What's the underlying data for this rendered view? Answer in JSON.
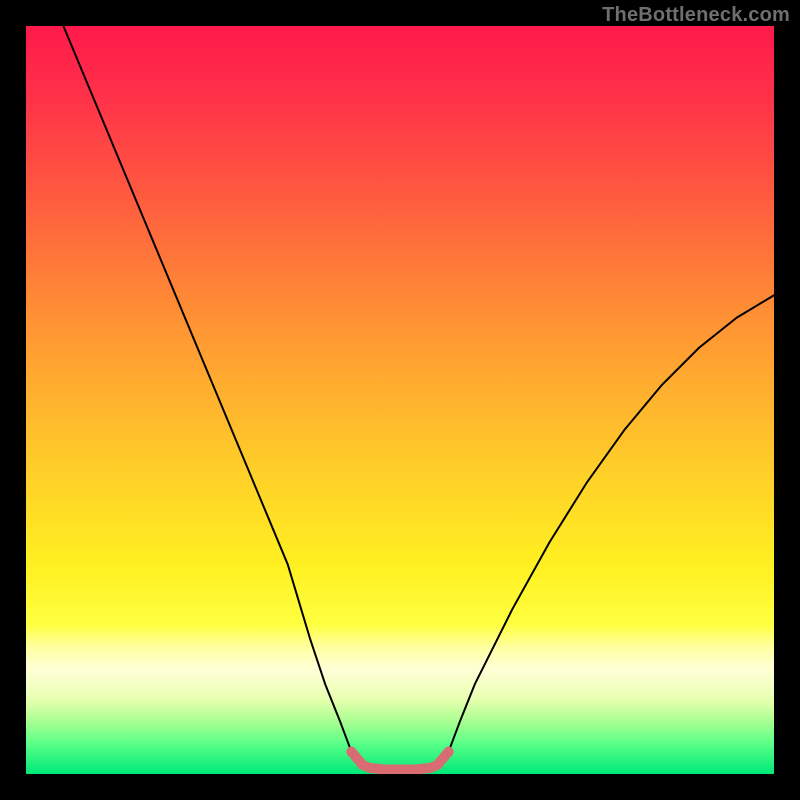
{
  "watermark": "TheBottleneck.com",
  "chart_data": {
    "type": "line",
    "title": "",
    "xlabel": "",
    "ylabel": "",
    "xlim": [
      0,
      100
    ],
    "ylim": [
      0,
      100
    ],
    "background_gradient": {
      "top": "#ff1a4b",
      "mid_upper": "#ff8436",
      "mid": "#ffd028",
      "mid_lower": "#ffff40",
      "bottom": "#00e878"
    },
    "series": [
      {
        "name": "bottleneck-curve",
        "color": "#000000",
        "width": 2,
        "x": [
          5,
          10,
          15,
          20,
          25,
          30,
          35,
          38,
          40,
          42,
          43.5,
          46,
          50,
          54,
          56.5,
          58,
          60,
          65,
          70,
          75,
          80,
          85,
          90,
          95,
          100
        ],
        "y": [
          100,
          88,
          76,
          64,
          52,
          40,
          28,
          18,
          12,
          7,
          3,
          0.8,
          0.6,
          0.8,
          3,
          7,
          12,
          22,
          31,
          39,
          46,
          52,
          57,
          61,
          64
        ]
      },
      {
        "name": "highlight-band",
        "color": "#d96b72",
        "width": 10,
        "x": [
          43.5,
          45,
          46,
          48,
          50,
          52,
          54,
          55,
          56.5
        ],
        "y": [
          3,
          1.2,
          0.8,
          0.6,
          0.6,
          0.6,
          0.8,
          1.2,
          3
        ]
      }
    ]
  }
}
